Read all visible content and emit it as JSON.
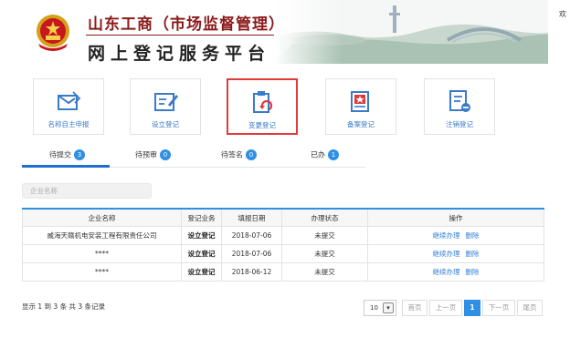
{
  "header": {
    "title_line1": "山东工商（市场监督管理）",
    "title_line2": "网上登记服务平台",
    "welcome": "欢"
  },
  "tiles": [
    {
      "label": "名称自主申报",
      "icon": "envelope-pen-icon"
    },
    {
      "label": "设立登记",
      "icon": "form-pen-icon"
    },
    {
      "label": "变更登记",
      "icon": "clipboard-refresh-icon"
    },
    {
      "label": "备案登记",
      "icon": "file-star-icon"
    },
    {
      "label": "注销登记",
      "icon": "document-minus-icon"
    }
  ],
  "active_tile": "变更登记",
  "tabs": [
    {
      "label": "待提交",
      "count": "3"
    },
    {
      "label": "待预审",
      "count": "0"
    },
    {
      "label": "待签名",
      "count": "0"
    },
    {
      "label": "已办",
      "count": "1"
    }
  ],
  "search": {
    "placeholder": "企业名称"
  },
  "table": {
    "headers": [
      "企业名称",
      "登记业务",
      "填报日期",
      "办理状态",
      "操作"
    ],
    "rows": [
      {
        "name": "威海天赣机电安装工程有限责任公司",
        "business": "设立登记",
        "date": "2018-07-06",
        "status": "未提交",
        "action1": "继续办理",
        "action2": "删除"
      },
      {
        "name": "****",
        "business": "设立登记",
        "date": "2018-07-06",
        "status": "未提交",
        "action1": "继续办理",
        "action2": "删除"
      },
      {
        "name": "****",
        "business": "设立登记",
        "date": "2018-06-12",
        "status": "未提交",
        "action1": "继续办理",
        "action2": "删除"
      }
    ]
  },
  "footer": {
    "summary": "显示 1 到 3 条 共 3 条记录",
    "page_size": "10",
    "first": "首页",
    "prev": "上一页",
    "current": "1",
    "next": "下一页",
    "last": "尾页"
  },
  "colors": {
    "accent": "#2f8fe3",
    "title_red": "#8b1a1a",
    "highlight_border": "#e03a3a",
    "link": "#3a7ac7"
  }
}
